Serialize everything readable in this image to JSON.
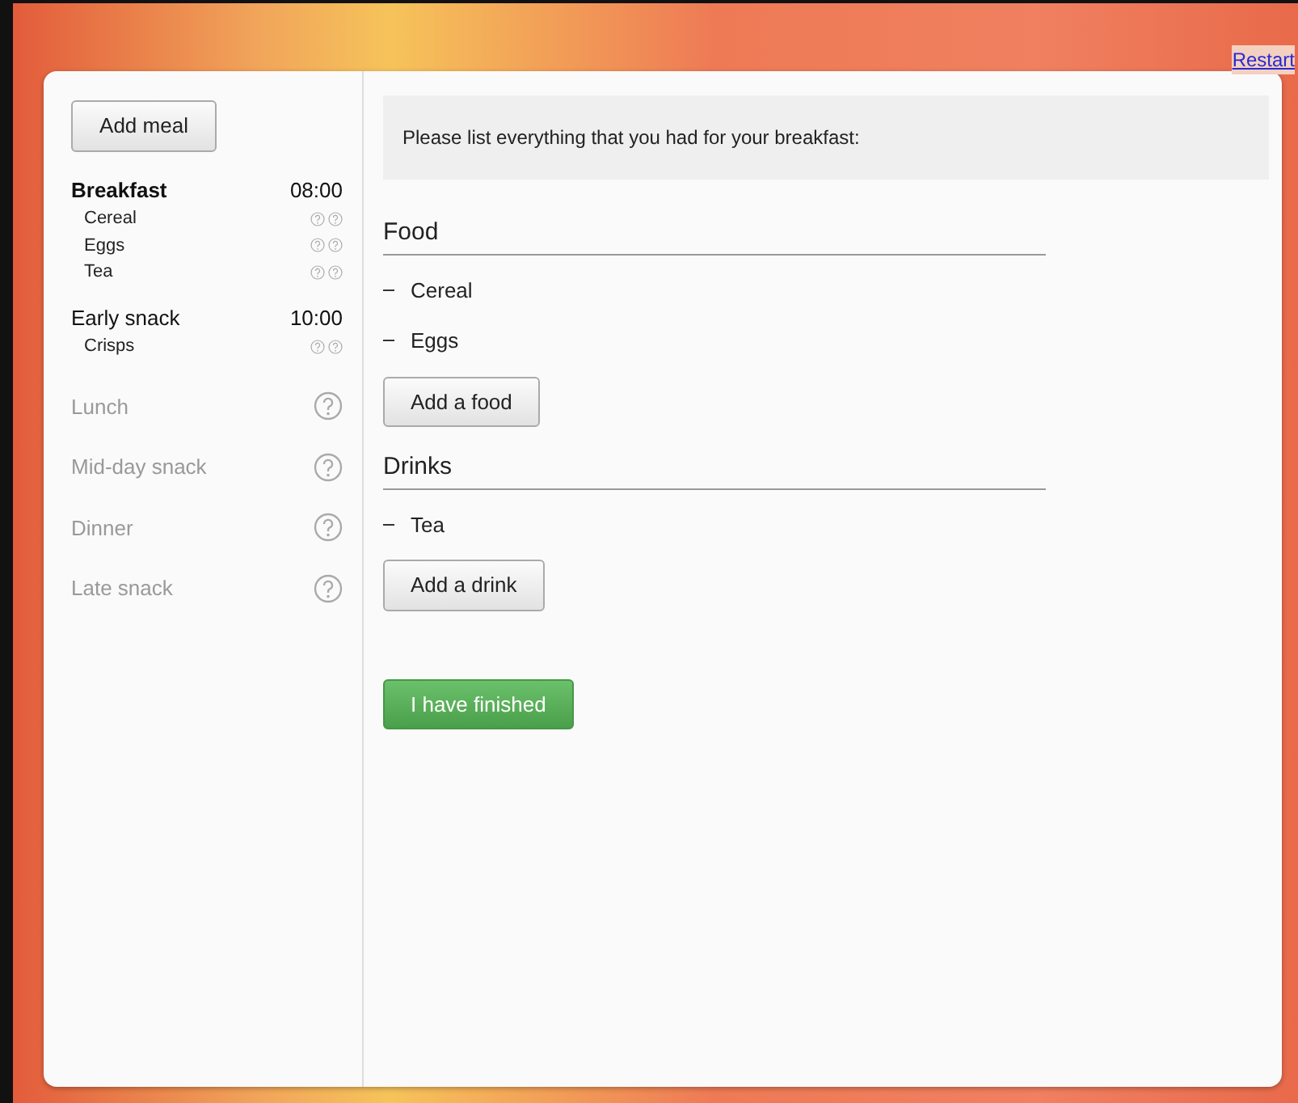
{
  "restart_link": "Restart",
  "sidebar": {
    "add_button": "Add meal",
    "meals": [
      {
        "name": "Breakfast",
        "time": "08:00",
        "selected": true,
        "completed": true,
        "items": [
          "Cereal",
          "Eggs",
          "Tea"
        ]
      },
      {
        "name": "Early snack",
        "time": "10:00",
        "selected": false,
        "completed": true,
        "items": [
          "Crisps"
        ]
      },
      {
        "name": "Lunch",
        "selected": false,
        "completed": false
      },
      {
        "name": "Mid-day snack",
        "selected": false,
        "completed": false
      },
      {
        "name": "Dinner",
        "selected": false,
        "completed": false
      },
      {
        "name": "Late snack",
        "selected": false,
        "completed": false
      }
    ]
  },
  "prompt": "Please list everything that you had for your breakfast:",
  "sections": [
    {
      "heading": "Food",
      "items": [
        "Cereal",
        "Eggs"
      ],
      "button": "Add a food"
    },
    {
      "heading": "Drinks",
      "items": [
        "Tea"
      ],
      "button": "Add a drink"
    }
  ],
  "finish_button": "I have finished"
}
